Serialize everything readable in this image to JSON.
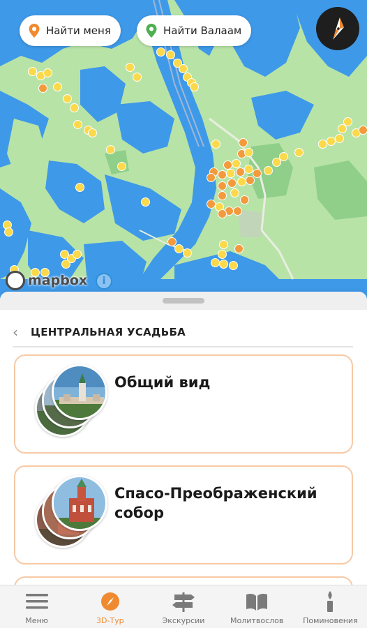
{
  "top_buttons": {
    "find_me": "Найти меня",
    "find_valaam": "Найти Валаам"
  },
  "map": {
    "attribution": "mapbox",
    "info": "i",
    "colors": {
      "land": "#b8e3a7",
      "water": "#3e99e8",
      "pin_yellow": "#fbd94a",
      "pin_orange": "#f39a3c"
    }
  },
  "section": {
    "back_icon": "chevron-left-icon",
    "title": "ЦЕНТРАЛЬНАЯ УСАДЬБА"
  },
  "cards": [
    {
      "title": "Общий вид"
    },
    {
      "title": "Спасо-Преображенский\nсобор"
    }
  ],
  "nav": {
    "items": [
      {
        "label": "Меню",
        "icon": "hamburger-icon"
      },
      {
        "label": "3D-Тур",
        "icon": "compass-icon",
        "active": true
      },
      {
        "label": "Экскурсии",
        "icon": "signpost-icon"
      },
      {
        "label": "Молитвослов",
        "icon": "book-icon"
      },
      {
        "label": "Поминовения",
        "icon": "candle-icon"
      }
    ],
    "accent": "#f08a30"
  }
}
